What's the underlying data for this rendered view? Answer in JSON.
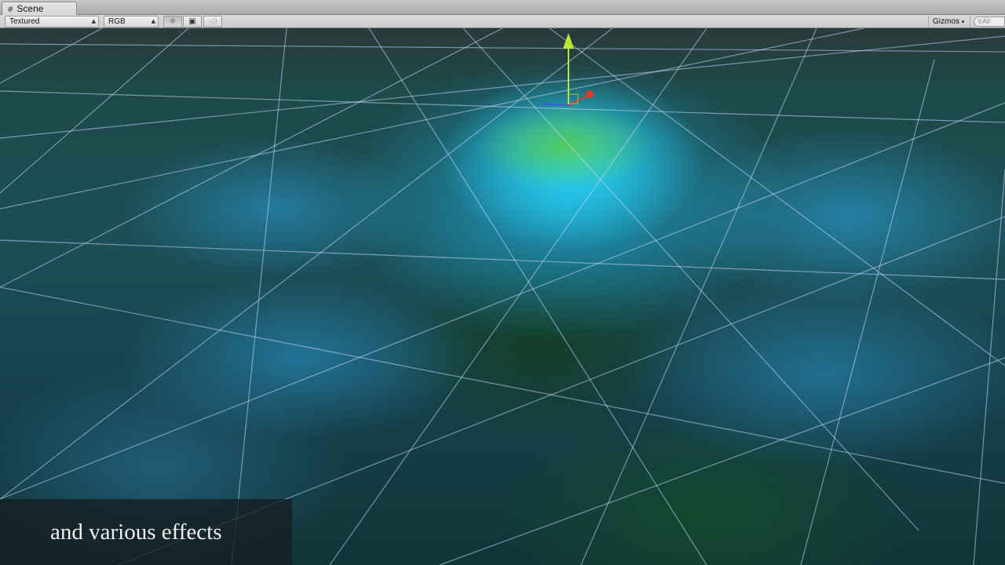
{
  "window": {
    "tab_label": "Scene",
    "tab_icon": "scene-grid-icon"
  },
  "toolbar": {
    "draw_mode": "Textured",
    "render_mode": "RGB",
    "lighting_icon": "sun-icon",
    "image_effects_icon": "image-icon",
    "audio_icon": "speaker-icon",
    "gizmos_label": "Gizmos",
    "search_placeholder": "All"
  },
  "caption": {
    "text": "and various effects"
  },
  "colors": {
    "gizmo_y_axis": "#b8e830",
    "gizmo_x_axis": "#e03a2a",
    "gizmo_z_axis": "#3a5cd8",
    "grid_line": "#c8d8ff"
  }
}
